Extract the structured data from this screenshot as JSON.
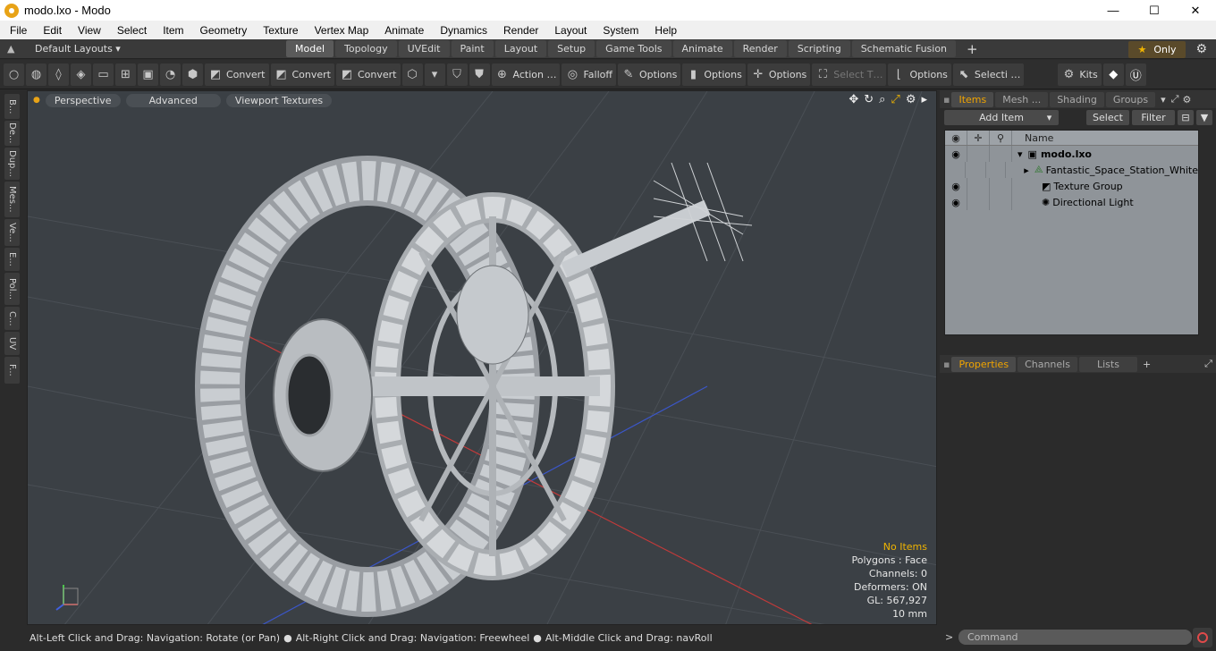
{
  "window": {
    "title": "modo.lxo - Modo",
    "minimize": "—",
    "maximize": "☐",
    "close": "✕"
  },
  "menu": [
    "File",
    "Edit",
    "View",
    "Select",
    "Item",
    "Geometry",
    "Texture",
    "Vertex Map",
    "Animate",
    "Dynamics",
    "Render",
    "Layout",
    "System",
    "Help"
  ],
  "layouts": {
    "label": "Default Layouts ▾"
  },
  "layout_tabs": [
    "Model",
    "Topology",
    "UVEdit",
    "Paint",
    "Layout",
    "Setup",
    "Game Tools",
    "Animate",
    "Render",
    "Scripting",
    "Schematic Fusion"
  ],
  "layout_active": "Model",
  "only_label": "Only",
  "toolbar": {
    "convert1": "Convert",
    "convert2": "Convert",
    "convert3": "Convert",
    "action": "Action …",
    "falloff": "Falloff",
    "options1": "Options",
    "options2": "Options",
    "options3": "Options",
    "select_t": "Select T…",
    "options4": "Options",
    "selecti": "Selecti …",
    "kits": "Kits"
  },
  "left_tabs": [
    "B...",
    "De...",
    "Dup...",
    "Mes...",
    "Ve...",
    "E...",
    "Pol...",
    "C...",
    "UV",
    "F..."
  ],
  "viewport": {
    "buttons": [
      "Perspective",
      "Advanced",
      "Viewport Textures"
    ],
    "info": {
      "no_items": "No Items",
      "polygons": "Polygons : Face",
      "channels": "Channels: 0",
      "deformers": "Deformers: ON",
      "gl": "GL: 567,927",
      "scale": "10 mm"
    }
  },
  "status": {
    "t1": "Alt-Left Click and Drag: Navigation: Rotate (or Pan)",
    "t2": "Alt-Right Click and Drag: Navigation: Freewheel",
    "t3": "Alt-Middle Click and Drag: navRoll"
  },
  "items_panel": {
    "tabs": [
      "Items",
      "Mesh ...",
      "Shading",
      "Groups"
    ],
    "add_item": "Add Item",
    "select": "Select",
    "filter": "Filter",
    "name_header": "Name",
    "rows": [
      {
        "label": "modo.lxo",
        "bold": true
      },
      {
        "label": "Fantastic_Space_Station_White"
      },
      {
        "label": "Texture Group"
      },
      {
        "label": "Directional Light"
      }
    ]
  },
  "props_panel": {
    "tabs": [
      "Properties",
      "Channels",
      "Lists"
    ]
  },
  "command": {
    "placeholder": "Command"
  }
}
